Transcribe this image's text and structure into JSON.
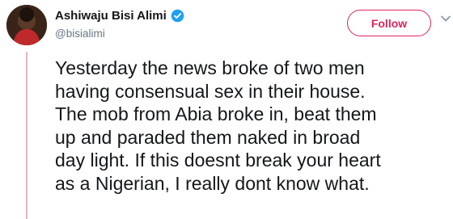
{
  "tweet": {
    "author": {
      "display_name": "Ashiwaju Bisi Alimi",
      "handle": "@bisialimi",
      "verified": true
    },
    "follow_label": "Follow",
    "text": "Yesterday the news broke of two men\nhaving consensual sex in their house.\nThe mob from Abia broke in, beat them\nup and paraded them naked in broad\nday light. If this doesnt break your heart\nas a Nigerian, I really dont know what."
  },
  "icons": {
    "verified": "verified-badge-icon",
    "menu": "chevron-down-icon"
  },
  "colors": {
    "accent": "#e0245e",
    "verified_blue": "#1da1f2",
    "secondary_text": "#657786",
    "thread_line": "#e8b4c6"
  }
}
